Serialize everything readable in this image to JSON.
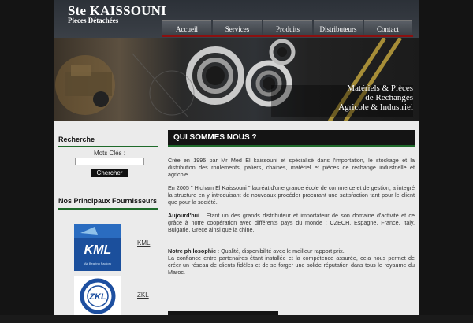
{
  "site": {
    "title": "Ste KAISSOUNI",
    "subtitle": "Pieces Détachées"
  },
  "nav": [
    "Accueil",
    "Services",
    "Produits",
    "Distributeurs",
    "Contact"
  ],
  "banner": {
    "line1": "Matériels & Pièces",
    "line2": "de Rechanges",
    "line3": "Agricole & Industriel"
  },
  "search": {
    "title": "Recherche",
    "label": "Mots Clés :",
    "button": "Chercher"
  },
  "suppliers": {
    "title": "Nos Principaux Fournisseurs",
    "items": [
      {
        "name": "KML",
        "logo_text": "KML",
        "logo_sub": "Air Bearing Factory"
      },
      {
        "name": "ZKL",
        "logo_text": "ZKL"
      }
    ]
  },
  "main": {
    "title": "QUI SOMMES NOUS ?",
    "p1": "Crée en 1995 par Mr Med El kaissouni et spécialisé dans l'importation, le stockage et la distribution des roulements, paliers, chaines, matériel et pièces de rechange industrielle et agricole.",
    "p2": "En 2005 \" Hicham El Kaissouni \" lauréat d'une grande école de commerce et de gestion, a integré la structure en y introduisant de nouveaux procéder procurant une satisfaction tant pour le client que pour la société.",
    "p3_bold": "Aujourd'hui",
    "p3": " : Etant un des grands distributeur et importateur de son domaine d'activité et ce grâce à notre coopération avec différents pays du monde : CZECH, Espagne, France, Italy, Bulgarie, Grece ainsi que la chine.",
    "p4_bold": "Notre philosophie",
    "p4": " : Qualité, disponibilité avec le meilleur rapport prix.",
    "p5": "La confiance entre partenaires étant installée et la compétence assurée, cela nous permet de créer un réseau de clients fidèles et de se forger une solide réputation dans tous le royaume du Maroc."
  }
}
